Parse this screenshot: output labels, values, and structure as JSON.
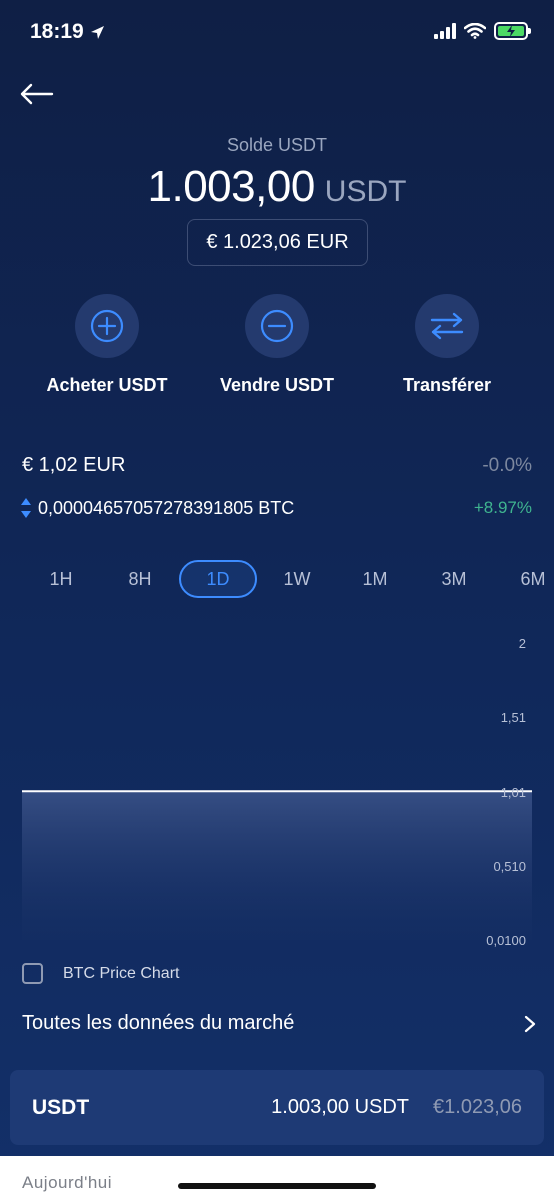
{
  "status_bar": {
    "time": "18:19"
  },
  "header": {
    "balance_label": "Solde USDT",
    "balance_amount": "1.003,00",
    "balance_unit": "USDT",
    "fiat_value": "€ 1.023,06 EUR"
  },
  "actions": [
    {
      "label": "Acheter USDT",
      "icon": "plus-circle-icon"
    },
    {
      "label": "Vendre USDT",
      "icon": "minus-circle-icon"
    },
    {
      "label": "Transférer",
      "icon": "transfer-arrows-icon"
    }
  ],
  "price": {
    "eur": "€ 1,02 EUR",
    "eur_change": "-0.0%",
    "btc": "0,00004657057278391805 BTC",
    "btc_change": "+8.97%"
  },
  "ranges": [
    "1H",
    "8H",
    "1D",
    "1W",
    "1M",
    "3M",
    "6M"
  ],
  "active_range": "1D",
  "chart_data": {
    "type": "area",
    "y_ticks": [
      "2",
      "1,51",
      "1,01",
      "0,510",
      "0,0100"
    ],
    "ylim": [
      0.01,
      2
    ],
    "values": [
      1.01,
      1.01,
      1.01,
      1.01,
      1.01,
      1.01,
      1.01,
      1.01,
      1.01,
      1.01
    ]
  },
  "btc_chart_toggle": {
    "label": "BTC Price Chart",
    "checked": false
  },
  "market_link": {
    "label": "Toutes les données du marché"
  },
  "asset_card": {
    "name": "USDT",
    "amount": "1.003,00 USDT",
    "fiat": "€1.023,06"
  },
  "bottom": {
    "today_label": "Aujourd'hui"
  },
  "colors": {
    "accent": "#3d8cff",
    "positive": "#3fb48f",
    "negative_neutral": "#7d889f"
  }
}
